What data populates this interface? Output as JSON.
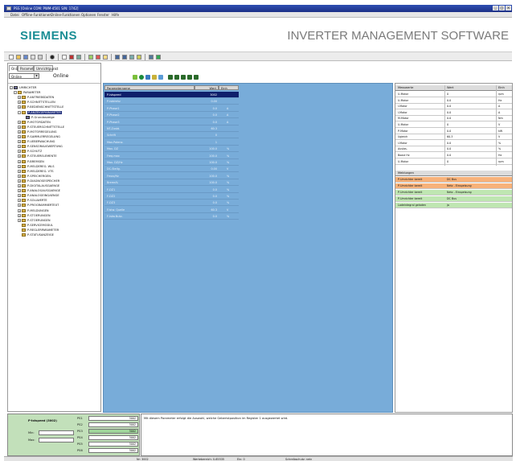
{
  "window": {
    "title": "PSS   [Online   COM: PWM-4501 S/N: 1742]"
  },
  "menu": [
    "Datei",
    "Offline-Funktionen",
    "Online-Funktionen",
    "Optionen",
    "Fenster",
    "Hilfe"
  ],
  "brand": {
    "logo": "SIEMENS",
    "subtitle": "INVERTER MANAGEMENT SOFTWARE",
    "logo_color": "#1b8e95"
  },
  "left": {
    "tabs": [
      "Online",
      "Parameter",
      "Umrichtpunkt"
    ],
    "mode_value": "Online",
    "mode_label": "Online",
    "tree": [
      {
        "label": "UMRICHTER",
        "level": 0,
        "type": "device",
        "exp": "-"
      },
      {
        "label": "PARAMETER",
        "level": 1,
        "type": "folder",
        "exp": "-"
      },
      {
        "label": "P-ANTRIEBSDATEN",
        "level": 2,
        "type": "folder",
        "exp": "+"
      },
      {
        "label": "P-SCHNITTSTELLEN",
        "level": 2,
        "type": "folder",
        "exp": "+"
      },
      {
        "label": "P-BEDIENSCHNITTSTELLE",
        "level": 2,
        "type": "folder",
        "exp": "+"
      },
      {
        "label": "P-ANZEIGEPARAMETER",
        "level": 2,
        "type": "folder",
        "exp": "-",
        "selected": true
      },
      {
        "label": "P-Grundanzeige",
        "level": 3,
        "type": "device",
        "exp": ""
      },
      {
        "label": "P-MOTORDATEN",
        "level": 2,
        "type": "folder",
        "exp": "+"
      },
      {
        "label": "P-STEUERSCHNITTSTELLE",
        "level": 2,
        "type": "folder",
        "exp": "+"
      },
      {
        "label": "P-MOTORREGELUNG",
        "level": 2,
        "type": "folder",
        "exp": "+"
      },
      {
        "label": "P-SAMMLERREGELUNG",
        "level": 2,
        "type": "folder",
        "exp": "+"
      },
      {
        "label": "P-UEBERWACHUNG",
        "level": 2,
        "type": "folder",
        "exp": "+"
      },
      {
        "label": "P-SENSORAUSWERTUNG",
        "level": 2,
        "type": "folder",
        "exp": "+"
      },
      {
        "label": "P-SCHUTZ",
        "level": 2,
        "type": "folder",
        "exp": "+"
      },
      {
        "label": "P-STEUERELEMENTE",
        "level": 2,
        "type": "folder",
        "exp": "+"
      },
      {
        "label": "P-BREMSEN",
        "level": 2,
        "type": "folder",
        "exp": "+"
      },
      {
        "label": "P-MELDEREG. WLS",
        "level": 2,
        "type": "folder",
        "exp": "+"
      },
      {
        "label": "P-MELDEREG. VTS",
        "level": 2,
        "type": "folder",
        "exp": "+"
      },
      {
        "label": "P-SPEICHERGEN.",
        "level": 2,
        "type": "folder",
        "exp": "+"
      },
      {
        "label": "P-DIAGNOSESPEICHER",
        "level": 2,
        "type": "folder",
        "exp": "+"
      },
      {
        "label": "P-DIGITALAUSGAENGE",
        "level": 2,
        "type": "folder",
        "exp": "+"
      },
      {
        "label": "P-ANALOGAUSGAENGE",
        "level": 2,
        "type": "folder",
        "exp": "+"
      },
      {
        "label": "P-ANALOGEINGAENGE",
        "level": 2,
        "type": "folder",
        "exp": "+"
      },
      {
        "label": "P-SOLLWERTE",
        "level": 2,
        "type": "folder",
        "exp": "+"
      },
      {
        "label": "P-PROGRAMMIERTEXT",
        "level": 2,
        "type": "folder",
        "exp": "+"
      },
      {
        "label": "P-MELDUNGEN",
        "level": 2,
        "type": "folder",
        "exp": "+"
      },
      {
        "label": "P-STOERUNGEN",
        "level": 2,
        "type": "folder",
        "exp": "+"
      },
      {
        "label": "P-STOERUNGEN",
        "level": 2,
        "type": "folder",
        "exp": "+"
      },
      {
        "label": "P-SERVICEMODUL",
        "level": 2,
        "type": "folder",
        "exp": ""
      },
      {
        "label": "P-REGLERPARAMETER",
        "level": 2,
        "type": "folder",
        "exp": ""
      },
      {
        "label": "P-STATUSANZEIGE",
        "level": 2,
        "type": "folder",
        "exp": ""
      }
    ]
  },
  "params": {
    "headers": [
      "Parametername",
      "Wert",
      "Einh"
    ],
    "rows": [
      {
        "name": "P-Istspeed",
        "value": "3002",
        "unit": "",
        "selected": true
      },
      {
        "name": "P-Istdrehz",
        "value": "0.00",
        "unit": ""
      },
      {
        "name": "P-Phase1",
        "value": "0.0",
        "unit": "A"
      },
      {
        "name": "P-Phase2",
        "value": "0.0",
        "unit": "A"
      },
      {
        "name": "P-Phase3",
        "value": "0.0",
        "unit": "A"
      },
      {
        "name": "NT-Zustd.",
        "value": "60.3",
        "unit": ""
      },
      {
        "name": "Schrift",
        "value": "0",
        "unit": ""
      },
      {
        "name": "Max.Potenz.",
        "value": "1",
        "unit": ""
      },
      {
        "name": "Max. DZ",
        "value": "100.0",
        "unit": "%"
      },
      {
        "name": "Freq.max",
        "value": "100.0",
        "unit": "%"
      },
      {
        "name": "Max. DZ/Hz",
        "value": "100.0",
        "unit": "%"
      },
      {
        "name": "DC-Stellg.",
        "value": "0.00",
        "unit": "V"
      },
      {
        "name": "Fmax/Hz",
        "value": "100.0",
        "unit": "%"
      },
      {
        "name": "Brems%",
        "value": "100.0",
        "unit": "%"
      },
      {
        "name": "F-DZ1",
        "value": "0.0",
        "unit": "%"
      },
      {
        "name": "F-DZ2",
        "value": "0.0",
        "unit": "%"
      },
      {
        "name": "F-DZ3",
        "value": "0.0",
        "unit": "%"
      },
      {
        "name": "F.Istw. Quelle",
        "value": "60.3",
        "unit": "V"
      },
      {
        "name": "F-Istw.Nutz.",
        "value": "0.0",
        "unit": "%"
      }
    ]
  },
  "right": {
    "top_headers": [
      "Messwerte",
      "Wert",
      "Einh"
    ],
    "top_rows": [
      {
        "name": "U-Motor",
        "value": "0",
        "unit": "rpm"
      },
      {
        "name": "U-Motor",
        "value": "0.0",
        "unit": "Hz"
      },
      {
        "name": "I-Motor",
        "value": "0.0",
        "unit": "A"
      },
      {
        "name": "I-Motor",
        "value": "0.0",
        "unit": "A"
      },
      {
        "name": "M-Motor",
        "value": "0.0",
        "unit": "Nm"
      },
      {
        "name": "U-Motor",
        "value": "0",
        "unit": "V"
      },
      {
        "name": "P-Motor",
        "value": "0.0",
        "unit": "kW"
      },
      {
        "name": "Ugleich",
        "value": "60.3",
        "unit": "V"
      },
      {
        "name": "I-Motor",
        "value": "0.0",
        "unit": "%"
      },
      {
        "name": "Auslas.",
        "value": "0.0",
        "unit": "%"
      },
      {
        "name": "Boost Hz",
        "value": "0.0",
        "unit": "Hz"
      },
      {
        "name": "U-Motor",
        "value": "0",
        "unit": "rpm"
      }
    ],
    "status_headers": [
      "Meldungen",
      ""
    ],
    "status_rows": [
      {
        "name": "P-Umrichter bereit",
        "value": "DC Bus",
        "color": "#f7b27a"
      },
      {
        "name": "P-Umrichter bereit",
        "value": "Netz - Einspeisung",
        "color": "#f7b27a"
      },
      {
        "name": "P-Umrichter bereit",
        "value": "Netz - Einspeisung",
        "color": "#bfe6b2"
      },
      {
        "name": "P-Umrichter bereit",
        "value": "DC Bus",
        "color": "#bfe6b2"
      },
      {
        "name": "Ladeintegral geladen",
        "value": "ja",
        "color": "#bfe6b2"
      }
    ]
  },
  "bottom": {
    "title": "P-Istspeed (3002)",
    "labels": [
      "Min:",
      "Max:",
      "Std:"
    ],
    "inputs": [
      "",
      ""
    ],
    "rows": [
      {
        "code": "PS1",
        "value": "3002"
      },
      {
        "code": "PS2",
        "value": "3002"
      },
      {
        "code": "PS3",
        "value": "3002"
      },
      {
        "code": "PS4",
        "value": "3002"
      },
      {
        "code": "PS5",
        "value": "3002"
      },
      {
        "code": "PS6",
        "value": "3002"
      }
    ],
    "message": "Mit diesem Parameter erfolgt die Auswahl, welche Geberistposition im Register 1 ausgewertet wird."
  },
  "status": [
    "Nr: 3002",
    "Wertebereich: 0-65535",
    "Ein: 0",
    "Schreibschutz: nein"
  ]
}
